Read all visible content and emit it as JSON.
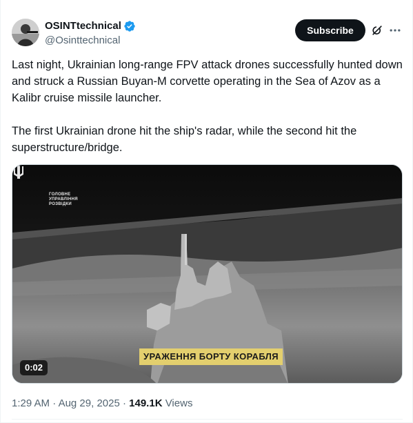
{
  "author": {
    "display_name": "OSINTtechnical",
    "handle": "@Osinttechnical",
    "verified": true,
    "verified_color": "#1d9bf0"
  },
  "actions": {
    "subscribe_label": "Subscribe",
    "grok_icon": "grok-icon",
    "more_icon": "more-icon"
  },
  "tweet": {
    "paragraphs": [
      "Last night, Ukrainian long-range FPV attack drones successfully hunted down and struck a Russian Buyan-M corvette operating in the Sea of Azov as a Kalibr cruise missile launcher.",
      "The first Ukrainian drone hit the ship's radar, while the second hit the superstructure/bridge."
    ]
  },
  "media": {
    "type": "video",
    "duration": "0:02",
    "caption": "УРАЖЕННЯ БОРТУ КОРАБЛЯ",
    "logo_lines": [
      "ГОЛОВНЕ",
      "УПРАВЛІННЯ",
      "РОЗВІДКИ"
    ]
  },
  "meta": {
    "time": "1:29 AM",
    "separator": "·",
    "date": "Aug 29, 2025",
    "views_count": "149.1K",
    "views_label": "Views"
  }
}
